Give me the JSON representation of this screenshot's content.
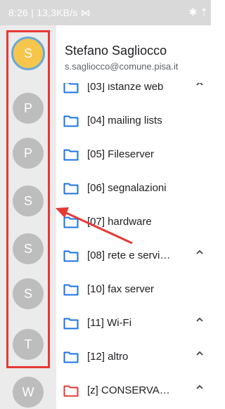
{
  "status_bar": {
    "time_speed": "8:26 | 13,3KB/s ⋈",
    "right_glyph": "✱ ⇡"
  },
  "account": {
    "name": "Stefano Sagliocco",
    "email": "s.sagliocco@comune.pisa.it"
  },
  "avatars": [
    {
      "letter": "S",
      "active": true
    },
    {
      "letter": "P"
    },
    {
      "letter": "P"
    },
    {
      "letter": "S"
    },
    {
      "letter": "S"
    },
    {
      "letter": "S"
    },
    {
      "letter": "T"
    },
    {
      "letter": "W"
    }
  ],
  "folders": [
    {
      "label": "[03] istanze web",
      "expand": "up",
      "color": "#1a73e8"
    },
    {
      "label": "[04] mailing lists",
      "color": "#1a73e8"
    },
    {
      "label": "[05] Fileserver",
      "color": "#1a73e8"
    },
    {
      "label": "[06] segnalazioni",
      "color": "#1a73e8"
    },
    {
      "label": "[07] hardware",
      "color": "#1a73e8"
    },
    {
      "label": "[08] rete e servi…",
      "expand": "up",
      "color": "#1a73e8"
    },
    {
      "label": "[10] fax server",
      "color": "#1a73e8"
    },
    {
      "label": "[11] Wi-Fi",
      "expand": "up",
      "color": "#1a73e8"
    },
    {
      "label": "[12] altro",
      "expand": "up",
      "color": "#1a73e8"
    },
    {
      "label": "[z] CONSERVA…",
      "expand": "up",
      "color": "#e53935"
    }
  ],
  "colors": {
    "annotation": "#e53935",
    "active_avatar_bg": "#f5c64b",
    "active_avatar_ring": "#6aa9d8",
    "avatar_bg": "#bdbdbd"
  }
}
